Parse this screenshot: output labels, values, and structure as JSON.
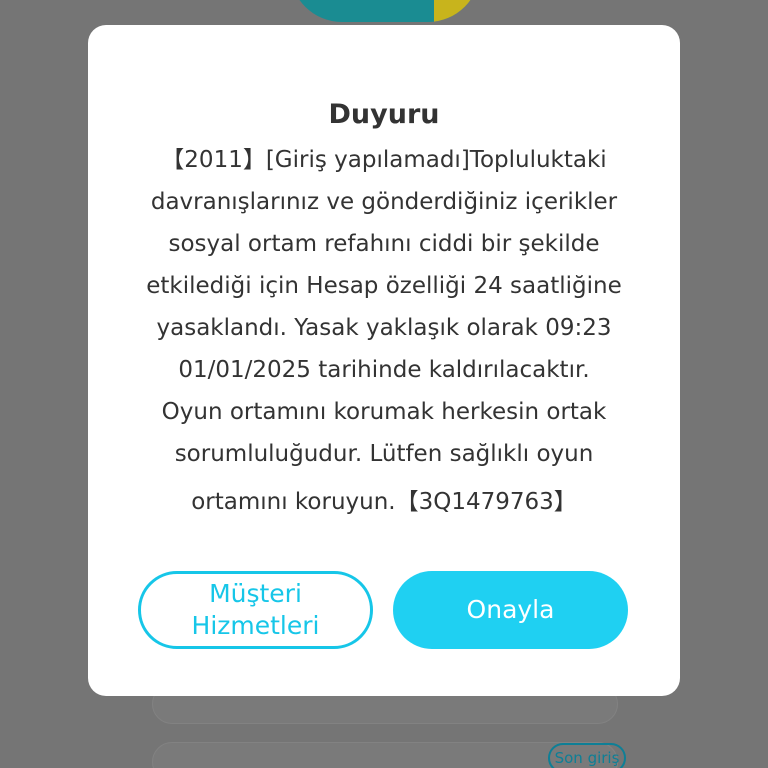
{
  "background": {
    "last_login_label": "Son giriş"
  },
  "dialog": {
    "title": "Duyuru",
    "message_lines": [
      "【2011】[Giriş yapılamadı]Topluluktaki",
      "davranışlarınız ve gönderdiğiniz içerikler",
      "sosyal ortam refahını ciddi bir şekilde",
      "etkilediği için Hesap özelliği 24 saatliğine",
      "yasaklandı. Yasak yaklaşık olarak 09:23",
      "01/01/2025 tarihinde kaldırılacaktır.",
      "Oyun ortamını korumak herkesin ortak",
      "sorumluluğudur. Lütfen sağlıklı oyun",
      "ortamını koruyun.【3Q1479763】"
    ],
    "support_button_label": "Müşteri Hizmetleri",
    "confirm_button_label": "Onayla"
  },
  "colors": {
    "overlay": "#757575",
    "accent": "#1fd0f2",
    "text": "#333333"
  }
}
